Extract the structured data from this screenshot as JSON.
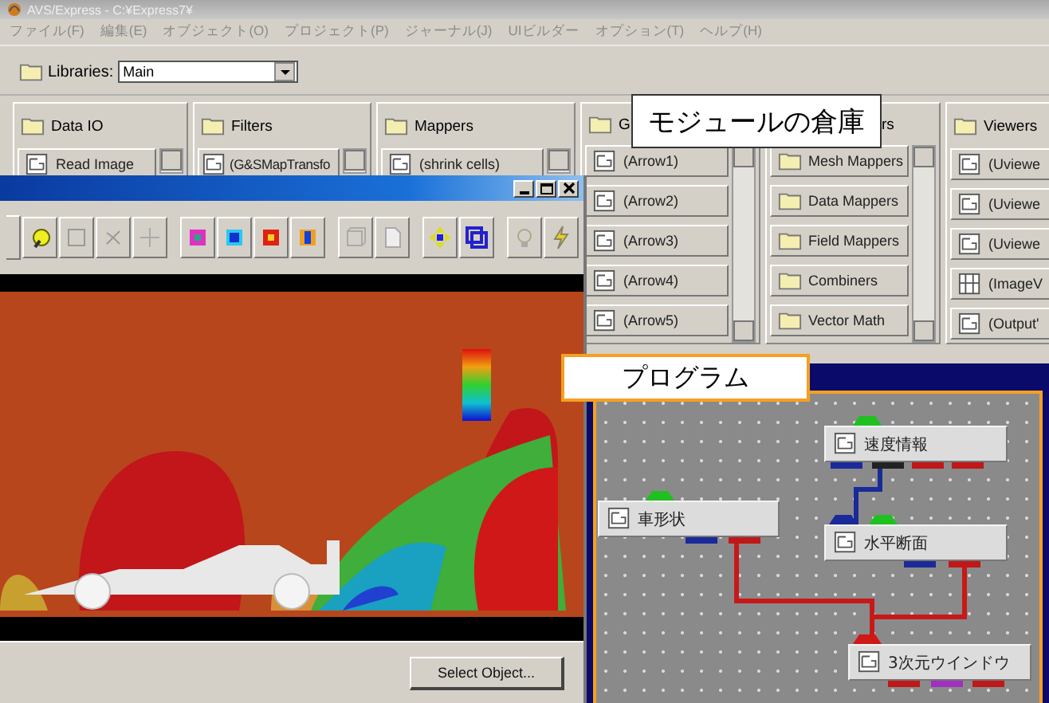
{
  "main_window": {
    "title": "AVS/Express - C:¥Express7¥",
    "menu": [
      "ファイル(F)",
      "編集(E)",
      "オブジェクト(O)",
      "プロジェクト(P)",
      "ジャーナル(J)",
      "UIビルダー",
      "オプション(T)",
      "ヘルプ(H)"
    ],
    "libraries": {
      "label": "Libraries:",
      "value": "Main"
    },
    "library_panels": [
      {
        "title": "Data IO",
        "items": [
          {
            "label": "Read Image",
            "kind": "module"
          }
        ]
      },
      {
        "title": "Filters",
        "items": [
          {
            "label": "(G&SMapTransfo",
            "kind": "module"
          }
        ]
      },
      {
        "title": "Mappers",
        "items": [
          {
            "label": "(shrink cells)",
            "kind": "module"
          }
        ]
      },
      {
        "title": "G",
        "items": [
          {
            "label": "(Arrow1)",
            "kind": "module"
          },
          {
            "label": "(Arrow2)",
            "kind": "module"
          },
          {
            "label": "(Arrow3)",
            "kind": "module"
          },
          {
            "label": "(Arrow4)",
            "kind": "module"
          },
          {
            "label": "(Arrow5)",
            "kind": "module"
          }
        ]
      },
      {
        "title": "rs",
        "items": [
          {
            "label": "Mesh Mappers",
            "kind": "folder"
          },
          {
            "label": "Data Mappers",
            "kind": "folder"
          },
          {
            "label": "Field Mappers",
            "kind": "folder"
          },
          {
            "label": "Combiners",
            "kind": "folder"
          },
          {
            "label": "Vector Math",
            "kind": "folder"
          }
        ]
      },
      {
        "title": "Viewers",
        "items": [
          {
            "label": "(Uviewe",
            "kind": "module"
          },
          {
            "label": "(Uviewe",
            "kind": "module"
          },
          {
            "label": "(Uviewe",
            "kind": "module"
          },
          {
            "label": "(ImageV",
            "kind": "grid"
          },
          {
            "label": "(Output'",
            "kind": "module"
          }
        ]
      }
    ]
  },
  "viewer_window": {
    "button": "Select Object..."
  },
  "network_editor": {
    "nodes": [
      {
        "label": "速度情報"
      },
      {
        "label": "車形状"
      },
      {
        "label": "水平断面"
      },
      {
        "label": "3次元ウインドウ"
      }
    ]
  },
  "callouts": [
    {
      "text": "モジュールの倉庫",
      "kind": "plain"
    },
    {
      "text": "プログラム",
      "kind": "orange"
    }
  ]
}
